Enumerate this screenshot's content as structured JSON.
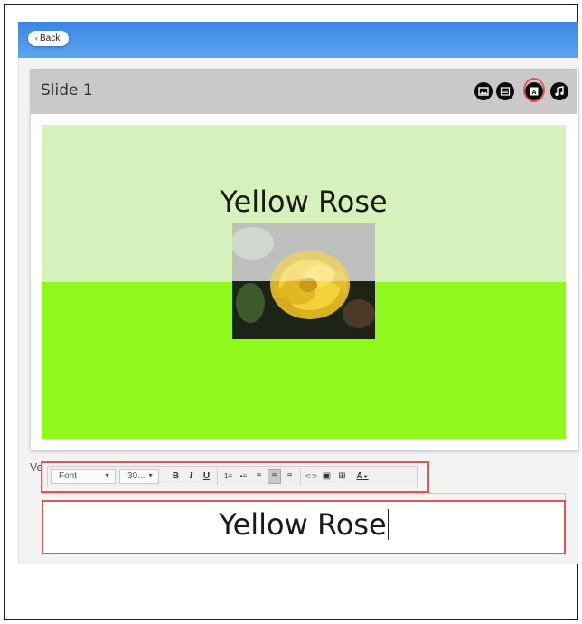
{
  "header": {
    "back_label": "Back"
  },
  "slide_panel": {
    "title": "Slide 1",
    "tools": [
      {
        "name": "image-tool-icon",
        "selected": false
      },
      {
        "name": "layout-tool-icon",
        "selected": false
      },
      {
        "name": "text-tool-icon",
        "selected": true
      },
      {
        "name": "music-tool-icon",
        "selected": false
      }
    ]
  },
  "slide": {
    "text": "Yellow Rose",
    "colors": {
      "top": "#d5f2bc",
      "bottom": "#8ef91b"
    }
  },
  "editor": {
    "label_fragment": "Ve",
    "font_select": "Font",
    "size_select": "30...",
    "buttons": [
      {
        "name": "bold-button",
        "glyph": "B"
      },
      {
        "name": "italic-button",
        "glyph": "I"
      },
      {
        "name": "underline-button",
        "glyph": "U"
      },
      {
        "name": "numbered-list-button",
        "glyph": "1≡"
      },
      {
        "name": "bulleted-list-button",
        "glyph": "•≡"
      },
      {
        "name": "align-left-button",
        "glyph": "≡"
      },
      {
        "name": "align-center-button",
        "glyph": "≡"
      },
      {
        "name": "align-right-button",
        "glyph": "≡"
      },
      {
        "name": "link-button",
        "glyph": "⊂⊃"
      },
      {
        "name": "image-button",
        "glyph": "▣"
      },
      {
        "name": "table-button",
        "glyph": "⊞"
      },
      {
        "name": "font-color-button",
        "glyph": "A"
      }
    ],
    "text": "Yellow Rose"
  }
}
